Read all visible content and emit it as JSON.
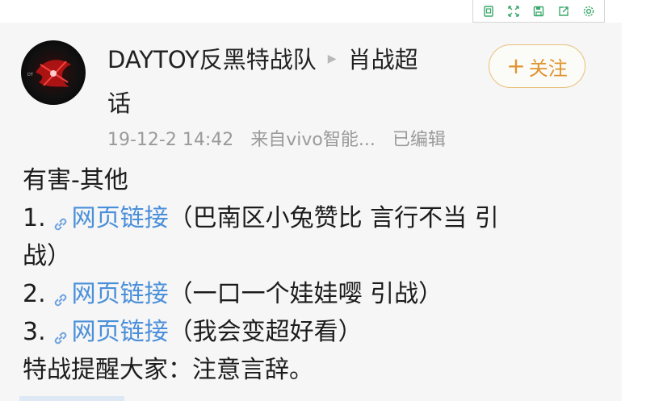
{
  "toolbar": {
    "icons": [
      "copy-icon",
      "expand-icon",
      "save-icon",
      "share-icon",
      "settings-icon"
    ]
  },
  "post": {
    "username": "DAYTOY反黑特战队",
    "arrow": "▶",
    "topic_line1": "肖战超",
    "topic_line2": "话",
    "follow_plus": "+",
    "follow_label": "关注",
    "timestamp": "19-12-2 14:42",
    "source": "来自vivo智能...",
    "edited": "已编辑",
    "lines": {
      "l1": "有害-其他",
      "l2_num": "1.",
      "l2_link": "网页链接",
      "l2_rest": "（巴南区小兔赞比 言行不当 引",
      "l3": "战）",
      "l4_num": "2.",
      "l4_link": "网页链接",
      "l4_rest": "（一口一个娃娃嘤 引战）",
      "l5_num": "3.",
      "l5_link": "网页链接",
      "l5_rest": "（我会变超好看）",
      "l6": "特战提醒大家：注意言辞。"
    }
  },
  "colors": {
    "link": "#4a8fd9",
    "follow": "#e0932e",
    "meta": "#9a9a9a"
  }
}
